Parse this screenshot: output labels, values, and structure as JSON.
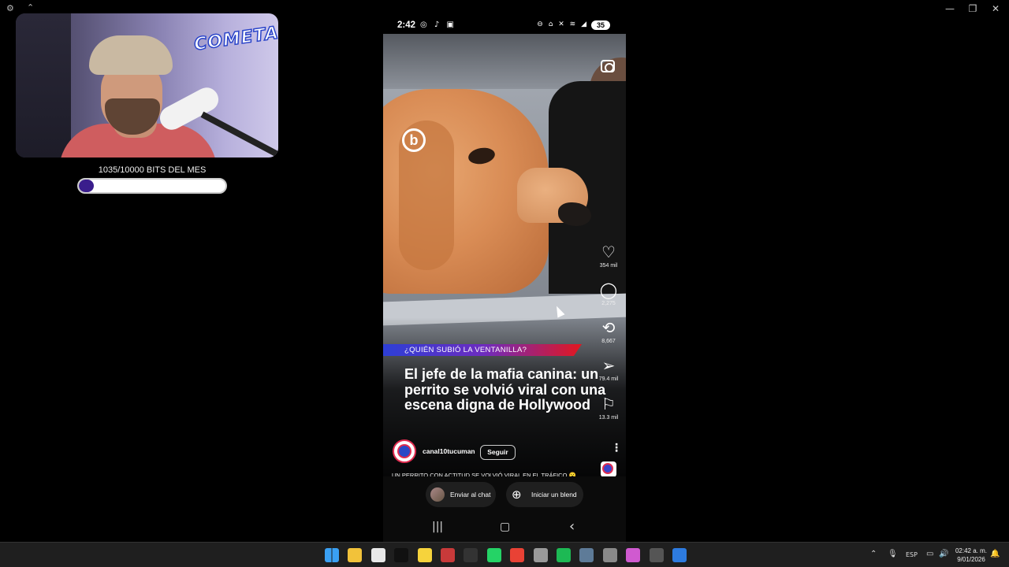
{
  "window": {
    "settings_icon": "gear-icon",
    "top_icon": "arrows-icon",
    "minimize": "—",
    "restore": "❐",
    "close": "✕"
  },
  "stream": {
    "webcam_logo": "COMETA",
    "bits_goal_label": "1035/10000 BITS DEL MES",
    "bits_progress": 0.1035
  },
  "phone": {
    "status": {
      "time": "2:42",
      "left_icons": "◎ ♪ ▣",
      "right_icons": "⊖ ⌂ ✕ ≋ ◢",
      "battery": "35"
    },
    "post": {
      "banner": "¿QUIÉN SUBIÓ LA VENTANILLA?",
      "headline": "El jefe de la mafia canina: un perrito se volvió viral con una escena digna de Hollywood",
      "watermark": "b",
      "actions": [
        {
          "icon": "heart-icon",
          "glyph": "♡",
          "count": "354 mil"
        },
        {
          "icon": "comment-icon",
          "glyph": "◯",
          "count": "2,275"
        },
        {
          "icon": "repost-icon",
          "glyph": "⟲",
          "count": "8,667"
        },
        {
          "icon": "send-icon",
          "glyph": "➢",
          "count": "79.4 mil"
        },
        {
          "icon": "bookmark-icon",
          "glyph": "⚐",
          "count": "13.3 mil"
        }
      ],
      "username": "canal10tucuman",
      "follow_label": "Seguir",
      "more_glyph": "⋮",
      "caption": "UN PERRITO CON ACTITUD SE VOLVIÓ VIRAL EN EL TRÁFICO 😮 ..."
    },
    "share": {
      "send_chat": "Enviar al chat",
      "start_blend": "Iniciar un blend",
      "blend_glyph": "⊕"
    },
    "nav": {
      "recents": "|||",
      "home": "▢",
      "back": "‹"
    }
  },
  "taskbar": {
    "apps": [
      {
        "name": "start-icon",
        "color": "#3aa0f3"
      },
      {
        "name": "file-explorer-icon",
        "color": "#f2c23a"
      },
      {
        "name": "store-icon",
        "color": "#e8e8e8"
      },
      {
        "name": "tiktok-icon",
        "color": "#111111"
      },
      {
        "name": "sticky-notes-icon",
        "color": "#f6d33c"
      },
      {
        "name": "game-icon",
        "color": "#c83a3a"
      },
      {
        "name": "terminal-icon",
        "color": "#333333"
      },
      {
        "name": "whatsapp-icon",
        "color": "#25d366"
      },
      {
        "name": "chrome-icon",
        "color": "#e94235"
      },
      {
        "name": "shield-icon",
        "color": "#9a9a9a"
      },
      {
        "name": "spotify-icon",
        "color": "#1db954"
      },
      {
        "name": "calculator-icon",
        "color": "#5e7b98"
      },
      {
        "name": "app-icon",
        "color": "#8a8a8a"
      },
      {
        "name": "puzzle-icon",
        "color": "#d05ad0"
      },
      {
        "name": "obs-icon",
        "color": "#555555"
      },
      {
        "name": "firefox-icon",
        "color": "#2d7be0"
      }
    ],
    "language": "ESP",
    "time": "02:42 a. m.",
    "date": "9/01/2026"
  }
}
